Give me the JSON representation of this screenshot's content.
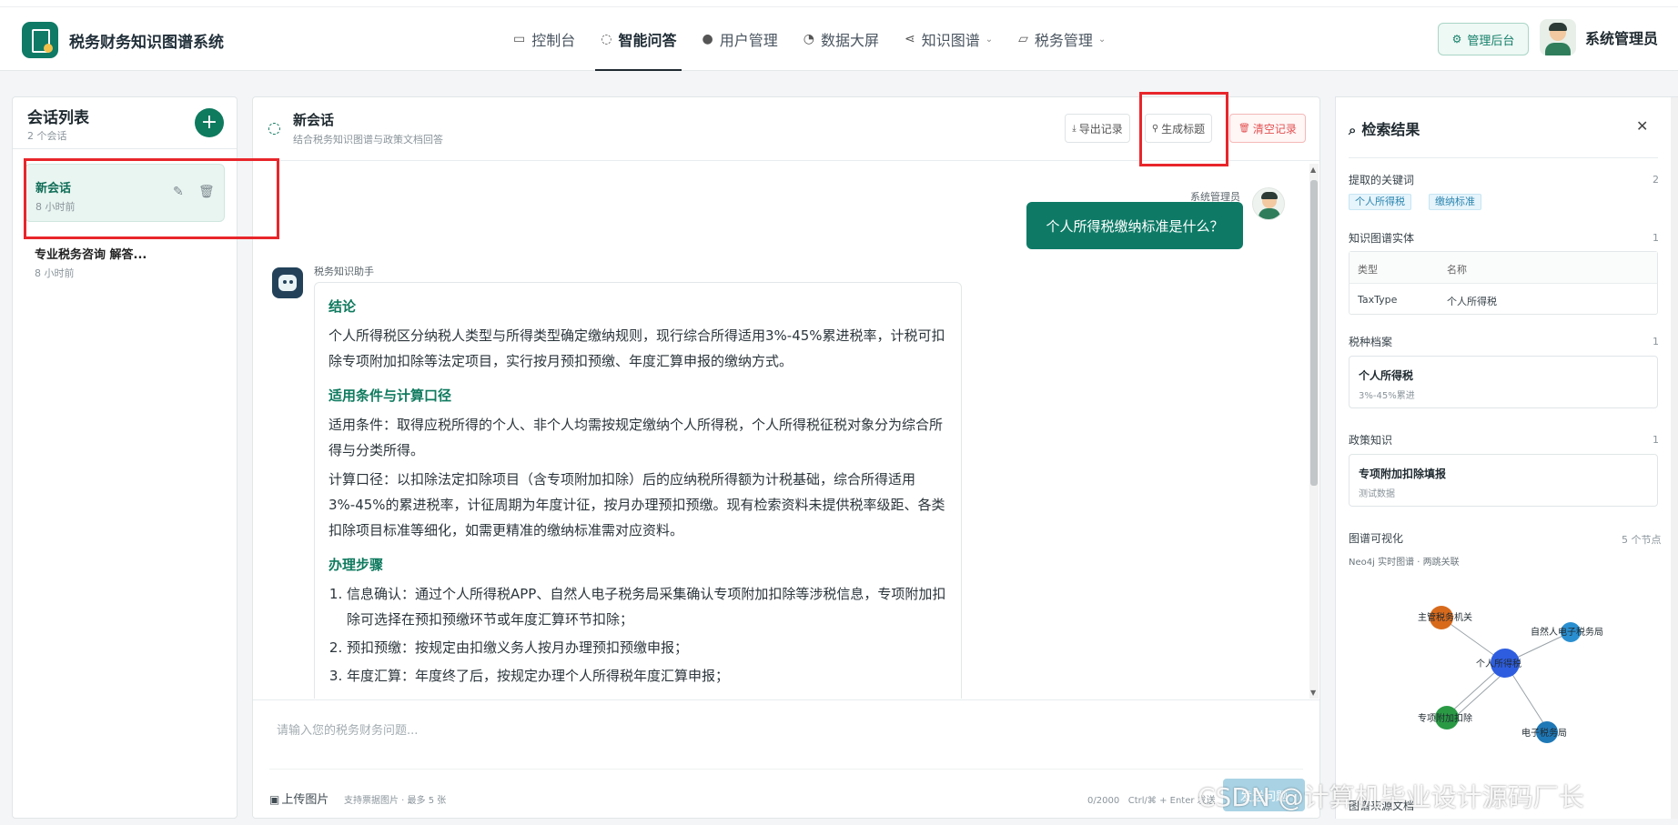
{
  "app": {
    "title": "税务财务知识图谱系统"
  },
  "nav": {
    "items": [
      {
        "label": "控制台",
        "icon": "monitor-icon"
      },
      {
        "label": "智能问答",
        "icon": "chat-icon",
        "active": true
      },
      {
        "label": "用户管理",
        "icon": "user-icon"
      },
      {
        "label": "数据大屏",
        "icon": "chart-pie-icon"
      },
      {
        "label": "知识图谱",
        "icon": "share-icon"
      },
      {
        "label": "税务管理",
        "icon": "folder-icon"
      }
    ]
  },
  "header": {
    "admin_label": "管理后台",
    "user_name": "系统管理员"
  },
  "sessions": {
    "title": "会话列表",
    "count": "2 个会话",
    "items": [
      {
        "name": "新会话",
        "time": "8 小时前"
      },
      {
        "name": "专业税务咨询 解答...",
        "time": "8 小时前"
      }
    ]
  },
  "chat": {
    "title": "新会话",
    "subtitle": "结合税务知识图谱与政策文档回答",
    "export_label": "导出记录",
    "title_gen_label": "生成标题",
    "clear_label": "清空记录",
    "user_label": "系统管理员",
    "user_question": "个人所得税缴纳标准是什么？",
    "bot_label": "税务知识助手",
    "answer": {
      "h1": "结论",
      "p1": "个人所得税区分纳税人类型与所得类型确定缴纳规则，现行综合所得适用3%-45%累进税率，计税可扣除专项附加扣除等法定项目，实行按月预扣预缴、年度汇算申报的缴纳方式。",
      "h2": "适用条件与计算口径",
      "p2": "适用条件：取得应税所得的个人、非个人均需按规定缴纳个人所得税，个人所得税征税对象分为综合所得与分类所得。",
      "p3": "计算口径：以扣除法定扣除项目（含专项附加扣除）后的应纳税所得额为计税基础，综合所得适用3%-45%的累进税率，计征周期为年度计征，按月办理预扣预缴。现有检索资料未提供税率级距、各类扣除项目标准等细化，如需更精准的缴纳标准需对应资料。",
      "h3": "办理步骤",
      "steps": [
        "信息确认：通过个人所得税APP、自然人电子税务局采集确认专项附加扣除等涉税信息，专项附加扣除可选择在预扣预缴环节或年度汇算环节扣除；",
        "预扣预缴：按规定由扣缴义务人按月办理预扣预缴申报；",
        "年度汇算：年度终了后，按规定办理个人所得税年度汇算申报；"
      ]
    },
    "input_placeholder": "请输入您的税务财务问题...",
    "upload_label": "上传图片",
    "upload_hint": "支持票据图片 · 最多 5 张",
    "counter": "0/2000",
    "shortcut": "Ctrl/⌘ + Enter 发送",
    "send_label": "发送问题"
  },
  "results": {
    "title": "检索结果",
    "keywords": {
      "title": "提取的关键词",
      "count": "2",
      "tags": [
        "个人所得税",
        "缴纳标准"
      ]
    },
    "entities": {
      "title": "知识图谱实体",
      "count": "1",
      "col_type": "类型",
      "col_name": "名称",
      "row_type": "TaxType",
      "row_name": "个人所得税"
    },
    "archive": {
      "title": "税种档案",
      "count": "1",
      "card_title": "个人所得税",
      "card_sub": "3%-45%累进"
    },
    "policy": {
      "title": "政策知识",
      "count": "1",
      "card_title": "专项附加扣除填报",
      "card_sub": "测试数据"
    },
    "graph": {
      "title": "图谱可视化",
      "count": "5 个节点",
      "sub": "Neo4j 实时图谱 · 两跳关联",
      "nodes": [
        "个人所得税",
        "主管税务机关",
        "自然人电子税务局",
        "专项附加扣除",
        "电子税务局"
      ]
    },
    "bottom_title": "图谱来源文档"
  },
  "watermark": "CSDN @计算机毕业设计源码厂长",
  "colors": {
    "primary": "#0e7a66",
    "accent_blue": "#2d86b0",
    "danger": "#e35151",
    "highlight_box": "#e8262b"
  }
}
